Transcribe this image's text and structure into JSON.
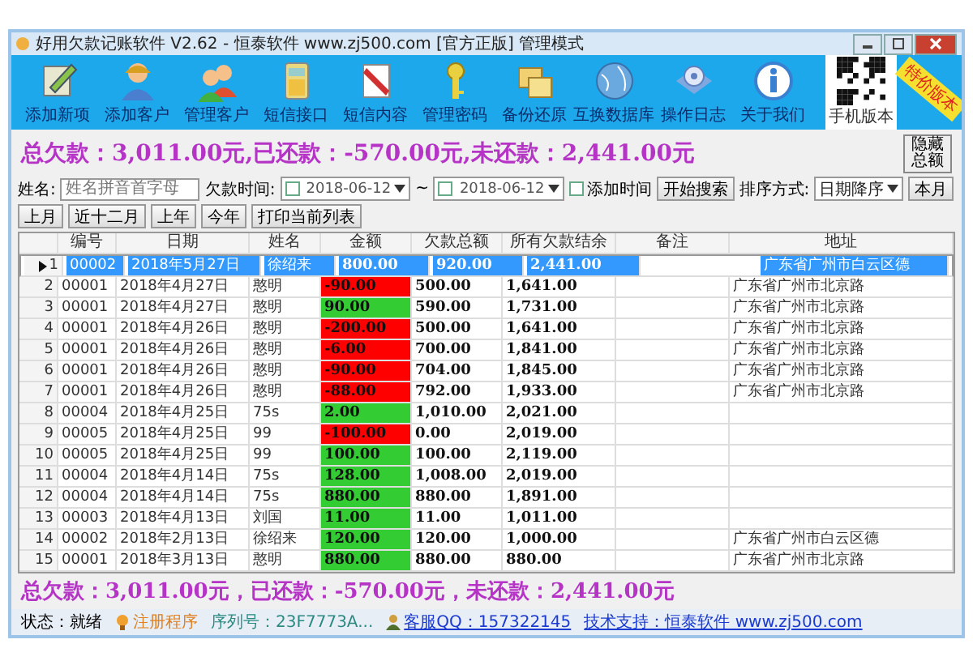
{
  "window": {
    "title": "好用欠款记账软件 V2.62 - 恒泰软件 www.zj500.com [官方正版] 管理模式"
  },
  "toolbar": [
    {
      "label": "添加新项"
    },
    {
      "label": "添加客户"
    },
    {
      "label": "管理客户"
    },
    {
      "label": "短信接口"
    },
    {
      "label": "短信内容"
    },
    {
      "label": "管理密码"
    },
    {
      "label": "备份还原"
    },
    {
      "label": "互换数据库"
    },
    {
      "label": "操作日志"
    },
    {
      "label": "关于我们"
    }
  ],
  "qr": {
    "label": "手机版本"
  },
  "ribbon": "特价版本",
  "summary": {
    "text": "总欠款：3,011.00元,已还款：-570.00元,未还款：2,441.00元",
    "hide_button": "隐藏总额"
  },
  "filter": {
    "name_label": "姓名:",
    "name_field": {
      "placeholder": "姓名拼音首字母"
    },
    "date_label": "欠款时间:",
    "date_from": {
      "value": "2018-06-12",
      "checked": false
    },
    "separator": "~",
    "date_to": {
      "value": "2018-06-12",
      "checked": false
    },
    "add_time": {
      "label": "添加时间",
      "checked": false
    },
    "search_button": "开始搜索",
    "sort_label": "排序方式:",
    "sort_value": "日期降序",
    "period_buttons": [
      "本月",
      "上月",
      "近十二月",
      "上年",
      "今年"
    ],
    "print_button": "打印当前列表"
  },
  "table": {
    "columns": [
      "编号",
      "日期",
      "姓名",
      "金额",
      "欠款总额",
      "所有欠款结余",
      "备注",
      "地址"
    ],
    "rows": [
      {
        "no": "1",
        "id": "00002",
        "date": "2018年5月27日",
        "name": "徐绍来",
        "amount": "800.00",
        "debt": "920.00",
        "balance": "2,441.00",
        "address": "广东省广州市白云区德",
        "selected": true
      },
      {
        "no": "2",
        "id": "00001",
        "date": "2018年4月27日",
        "name": "憨明",
        "amount": "-90.00",
        "color": "#ff0000",
        "debt": "500.00",
        "balance": "1,641.00",
        "address": "广东省广州市北京路",
        "selected": false
      },
      {
        "no": "3",
        "id": "00001",
        "date": "2018年4月27日",
        "name": "憨明",
        "amount": "90.00",
        "color": "#33cc33",
        "debt": "590.00",
        "balance": "1,731.00",
        "address": "广东省广州市北京路",
        "selected": false
      },
      {
        "no": "4",
        "id": "00001",
        "date": "2018年4月26日",
        "name": "憨明",
        "amount": "-200.00",
        "color": "#ff0000",
        "debt": "500.00",
        "balance": "1,641.00",
        "address": "广东省广州市北京路",
        "selected": false
      },
      {
        "no": "5",
        "id": "00001",
        "date": "2018年4月26日",
        "name": "憨明",
        "amount": "-6.00",
        "color": "#ff0000",
        "debt": "700.00",
        "balance": "1,841.00",
        "address": "广东省广州市北京路",
        "selected": false
      },
      {
        "no": "6",
        "id": "00001",
        "date": "2018年4月26日",
        "name": "憨明",
        "amount": "-90.00",
        "color": "#ff0000",
        "debt": "704.00",
        "balance": "1,845.00",
        "address": "广东省广州市北京路",
        "selected": false
      },
      {
        "no": "7",
        "id": "00001",
        "date": "2018年4月26日",
        "name": "憨明",
        "amount": "-88.00",
        "color": "#ff0000",
        "debt": "792.00",
        "balance": "1,933.00",
        "address": "广东省广州市北京路",
        "selected": false
      },
      {
        "no": "8",
        "id": "00004",
        "date": "2018年4月25日",
        "name": "75s",
        "amount": "2.00",
        "color": "#33cc33",
        "debt": "1,010.00",
        "balance": "2,021.00",
        "selected": false
      },
      {
        "no": "9",
        "id": "00005",
        "date": "2018年4月25日",
        "name": "99",
        "amount": "-100.00",
        "color": "#ff0000",
        "debt": "0.00",
        "balance": "2,019.00",
        "selected": false
      },
      {
        "no": "10",
        "id": "00005",
        "date": "2018年4月25日",
        "name": "99",
        "amount": "100.00",
        "color": "#33cc33",
        "debt": "100.00",
        "balance": "2,119.00",
        "selected": false
      },
      {
        "no": "11",
        "id": "00004",
        "date": "2018年4月14日",
        "name": "75s",
        "amount": "128.00",
        "color": "#33cc33",
        "debt": "1,008.00",
        "balance": "2,019.00",
        "selected": false
      },
      {
        "no": "12",
        "id": "00004",
        "date": "2018年4月14日",
        "name": "75s",
        "amount": "880.00",
        "color": "#33cc33",
        "debt": "880.00",
        "balance": "1,891.00",
        "selected": false
      },
      {
        "no": "13",
        "id": "00003",
        "date": "2018年4月13日",
        "name": "刘国",
        "amount": "11.00",
        "color": "#33cc33",
        "debt": "11.00",
        "balance": "1,011.00",
        "selected": false
      },
      {
        "no": "14",
        "id": "00002",
        "date": "2018年2月13日",
        "name": "徐绍来",
        "amount": "120.00",
        "color": "#33cc33",
        "debt": "120.00",
        "balance": "1,000.00",
        "address": "广东省广州市白云区德",
        "selected": false
      },
      {
        "no": "15",
        "id": "00001",
        "date": "2018年3月13日",
        "name": "憨明",
        "amount": "880.00",
        "color": "#33cc33",
        "debt": "880.00",
        "balance": "880.00",
        "address": "广东省广州市北京路",
        "selected": false
      }
    ]
  },
  "bottom_summary": "总欠款：3,011.00元，已还款：-570.00元，未还款：2,441.00元",
  "status_bar": {
    "state": "状态：就绪",
    "register": "注册程序",
    "serial": "序列号：23F7773A...",
    "support_qq": "客服QQ：157322145",
    "tech": "技术支持：恒泰软件 www.zj500.com"
  }
}
